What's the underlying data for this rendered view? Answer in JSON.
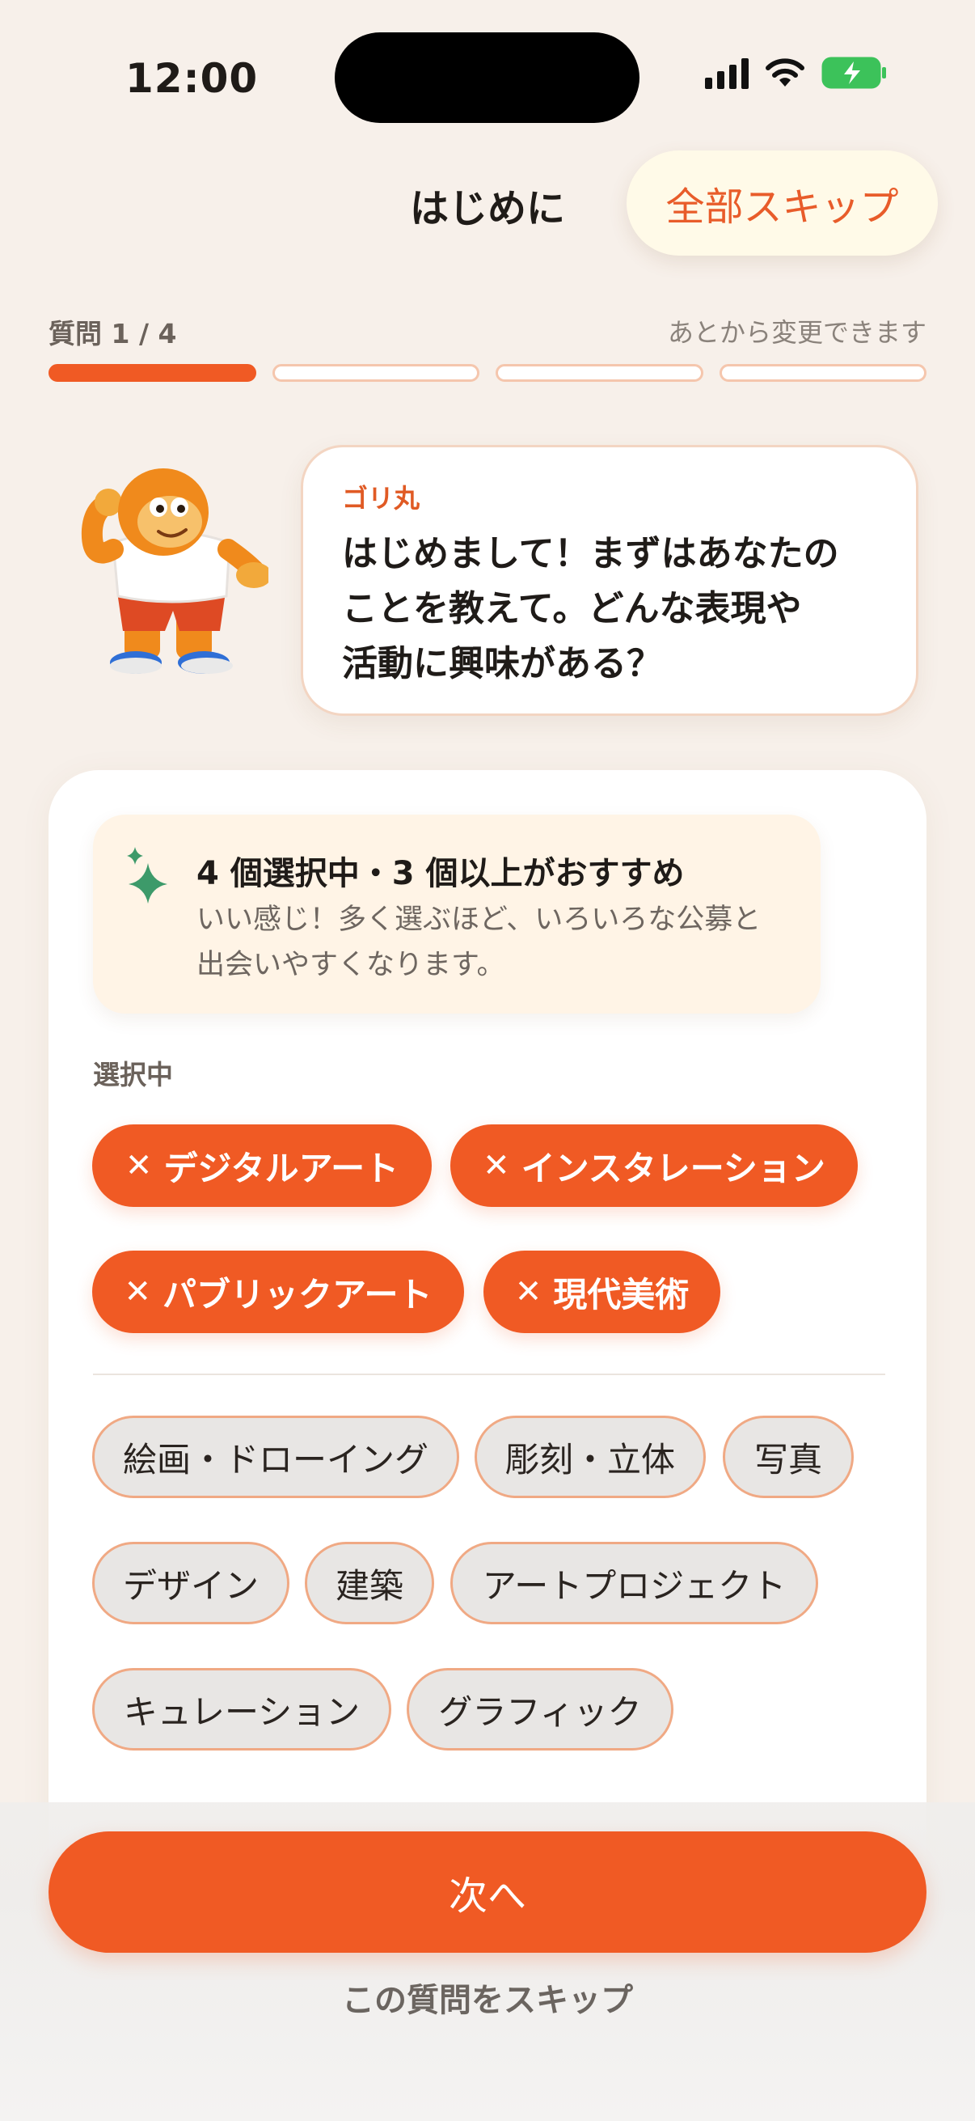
{
  "status_bar": {
    "time": "12:00"
  },
  "header": {
    "title": "はじめに",
    "skip_all_label": "全部スキップ"
  },
  "progress": {
    "label": "質問 1 / 4",
    "hint": "あとから変更できます",
    "current": 1,
    "total": 4
  },
  "speech": {
    "speaker": "ゴリ丸",
    "lines": [
      "はじめまして！まずはあなたの",
      "ことを教えて。どんな表現や",
      "活動に興味がある？"
    ]
  },
  "info": {
    "title": "4 個選択中・3 個以上がおすすめ",
    "sub_lines": [
      "いい感じ！多く選ぶほど、いろいろな公募と",
      "出会いやすくなります。"
    ]
  },
  "selected_label": "選択中",
  "selected_chips": [
    "デジタルアート",
    "インスタレーション",
    "パブリックアート",
    "現代美術"
  ],
  "options": [
    "絵画・ドローイング",
    "彫刻・立体",
    "写真",
    "デザイン",
    "建築",
    "アートプロジェクト",
    "キュレーション",
    "グラフィック"
  ],
  "remove_glyph": "✕",
  "footer": {
    "next_label": "次へ",
    "skip_question_label": "この質問をスキップ"
  },
  "colors": {
    "accent": "#f05a24",
    "background": "#f7f0ea",
    "chip_border": "#f0a984",
    "sparkle": "#3d9a6a"
  },
  "icons": [
    "signal-icon",
    "wifi-icon",
    "battery-charging-icon",
    "sparkle-icon",
    "close-icon",
    "gorilla-mascot"
  ]
}
